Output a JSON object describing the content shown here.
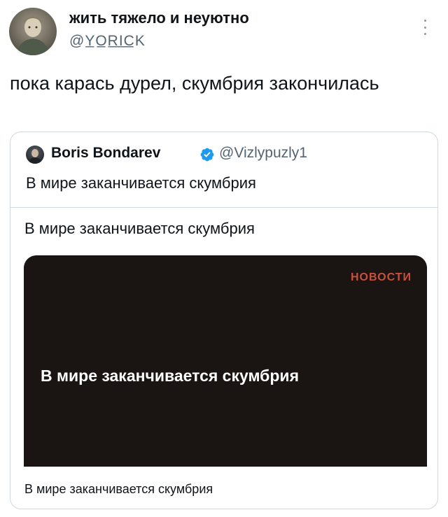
{
  "tweet": {
    "author_name": "жить тяжело и неуютно",
    "author_handle": "@Y̲O̲R̲I̲C̲K",
    "text": "пока карась дурел, скумбрия закончилась"
  },
  "quote": {
    "author_name": "Boris Bondarev",
    "author_handle": "@Vizlypuzly1",
    "text": "В мире заканчивается скумбрия",
    "link_card": {
      "title": "В мире заканчивается скумбрия",
      "image_tag": "НОВОСТИ",
      "image_headline": "В мире заканчивается скумбрия",
      "caption": "В мире заканчивается скумбрия"
    }
  },
  "colors": {
    "verified": "#1d9bf0",
    "tag": "#c8503c",
    "preview_bg": "#1a1412"
  }
}
